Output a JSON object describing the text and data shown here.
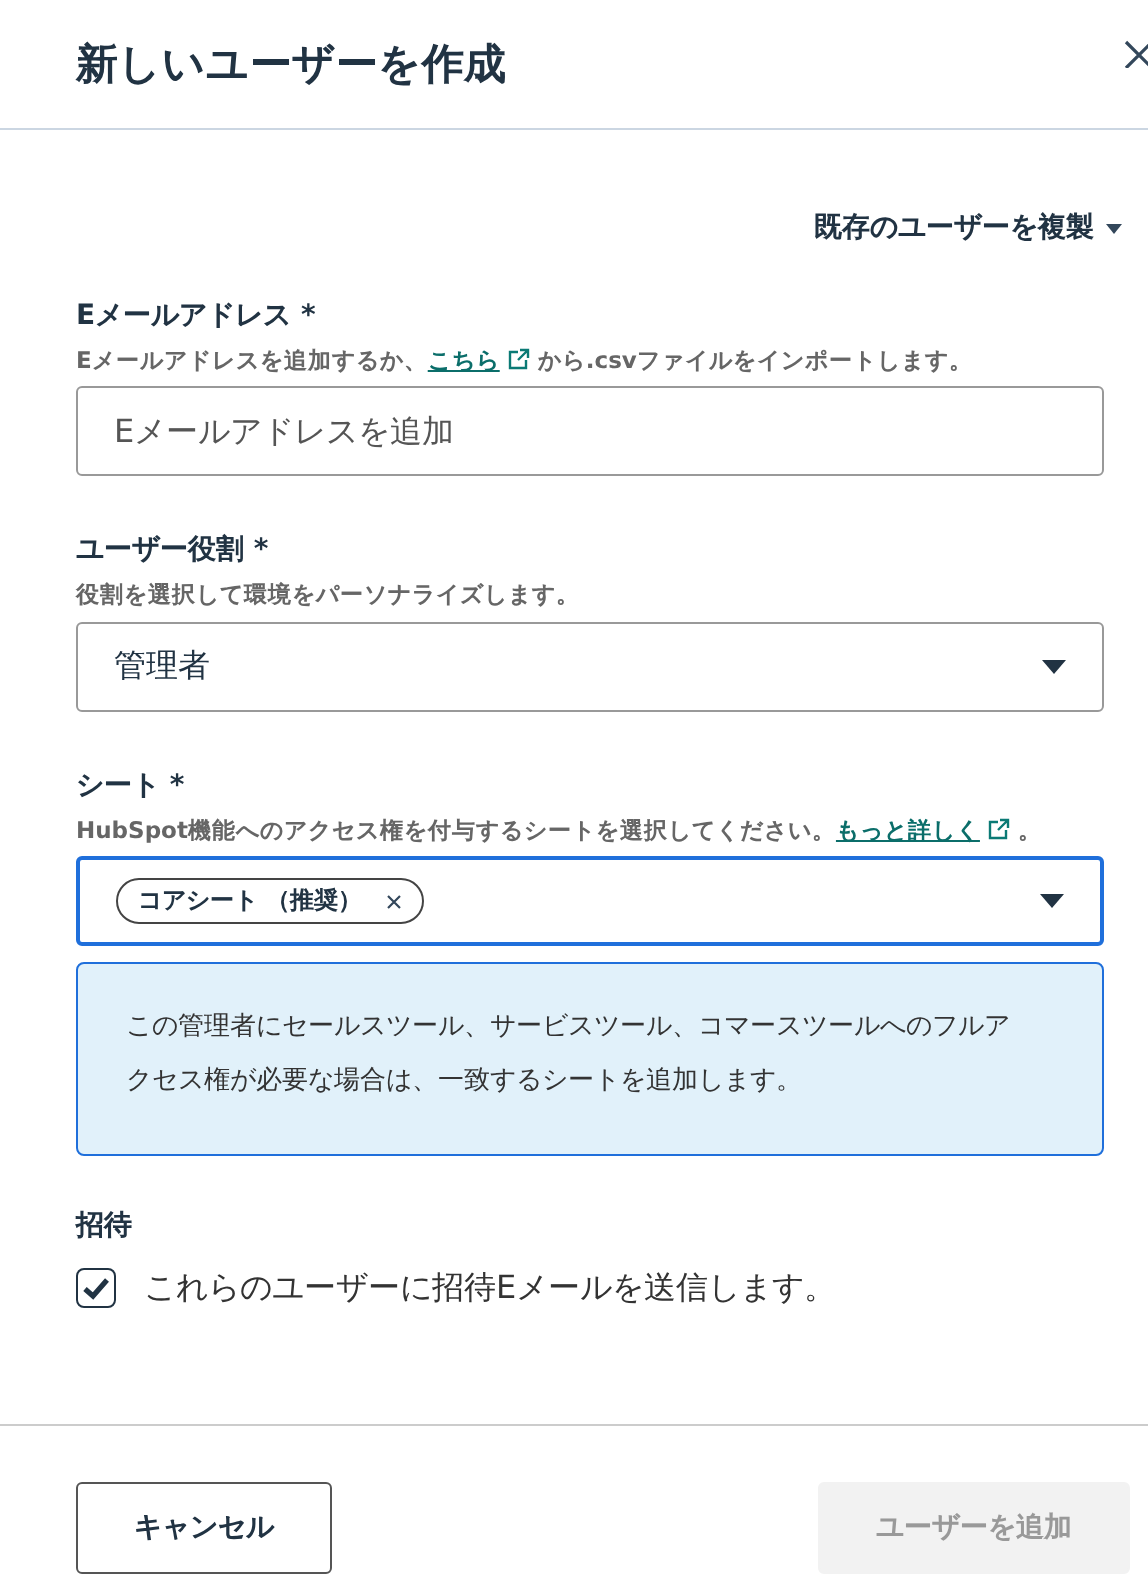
{
  "dialog": {
    "title": "新しいユーザーを作成"
  },
  "clone_menu": {
    "label": "既存のユーザーを複製"
  },
  "email": {
    "label": "Eメールアドレス *",
    "help_before": "Eメールアドレスを追加するか、",
    "help_link": "こちら",
    "help_after": "から.csvファイルをインポートします。",
    "placeholder": "Eメールアドレスを追加"
  },
  "role": {
    "label": "ユーザー役割 *",
    "help": "役割を選択して環境をパーソナライズします。",
    "value": "管理者"
  },
  "seats": {
    "label": "シート *",
    "help": "HubSpot機能へのアクセス権を付与するシートを選択してください。",
    "help_link": "もっと詳しく",
    "help_after": "。",
    "focused": true,
    "tags": [
      {
        "label": "コアシート （推奨）"
      }
    ]
  },
  "notice": {
    "text": "この管理者にセールスツール、サービスツール、コマースツールへのフルアクセス権が必要な場合は、一致するシートを追加します。"
  },
  "invite": {
    "label": "招待",
    "checkbox": {
      "label": "これらのユーザーに招待Eメールを送信します。",
      "checked": true
    }
  },
  "footer": {
    "buttons": [
      {
        "label": "キャンセル",
        "disabled": false
      },
      {
        "label": "ユーザーを追加",
        "disabled": true
      }
    ]
  }
}
